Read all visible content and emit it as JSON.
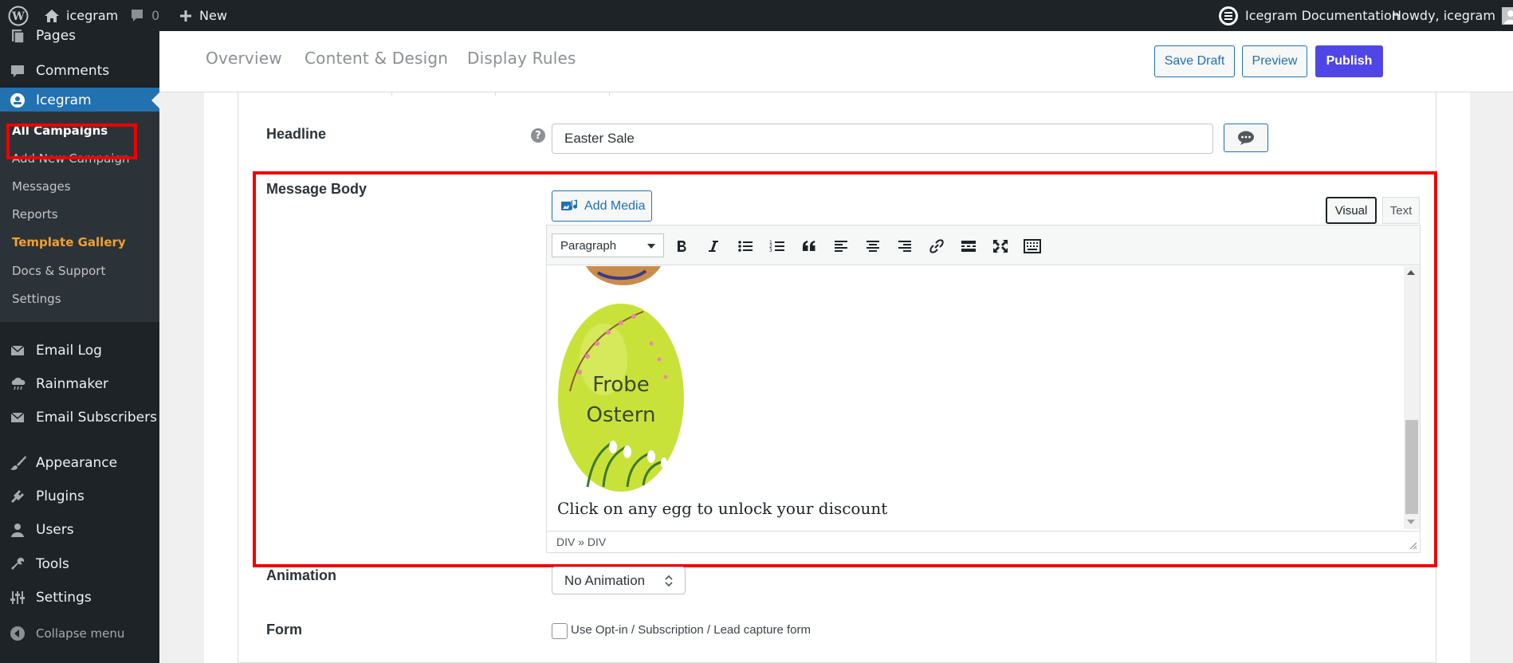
{
  "admin_bar": {
    "site_name": "icegram",
    "comment_count": "0",
    "new_label": "New",
    "docs_label": "Icegram Documentation",
    "greeting": "Howdy, icegram"
  },
  "sidebar": {
    "pages": "Pages",
    "comments": "Comments",
    "icegram": "Icegram",
    "submenu": {
      "all_campaigns": "All Campaigns",
      "add_new": "Add New Campaign",
      "messages": "Messages",
      "reports": "Reports",
      "template_gallery": "Template Gallery",
      "docs": "Docs & Support",
      "settings": "Settings"
    },
    "email_log": "Email Log",
    "rainmaker": "Rainmaker",
    "email_subscribers": "Email Subscribers",
    "appearance": "Appearance",
    "plugins": "Plugins",
    "users": "Users",
    "tools": "Tools",
    "settings": "Settings",
    "collapse": "Collapse menu"
  },
  "header": {
    "tabs": [
      "Overview",
      "Content & Design",
      "Display Rules"
    ],
    "save_draft": "Save Draft",
    "preview": "Preview",
    "publish": "Publish"
  },
  "form": {
    "headline_label": "Headline",
    "headline_value": "Easter Sale",
    "message_body_label": "Message Body",
    "add_media": "Add Media",
    "mode_visual": "Visual",
    "mode_text": "Text",
    "format_value": "Paragraph",
    "body_text": "Click on any egg to unlock your discount",
    "egg_text_line1": "Frobe",
    "egg_text_line2": "Ostern",
    "path": "DIV » DIV",
    "animation_label": "Animation",
    "animation_value": "No Animation",
    "form_label": "Form",
    "optin_label": "Use Opt-in / Subscription / Lead capture form"
  },
  "colors": {
    "admin_dark": "#1d2327",
    "wp_blue": "#2271b1",
    "publish": "#4f46e5",
    "highlight_red": "#ee0000",
    "gallery_orange": "#f0a030",
    "egg_green": "#c9e23a"
  }
}
